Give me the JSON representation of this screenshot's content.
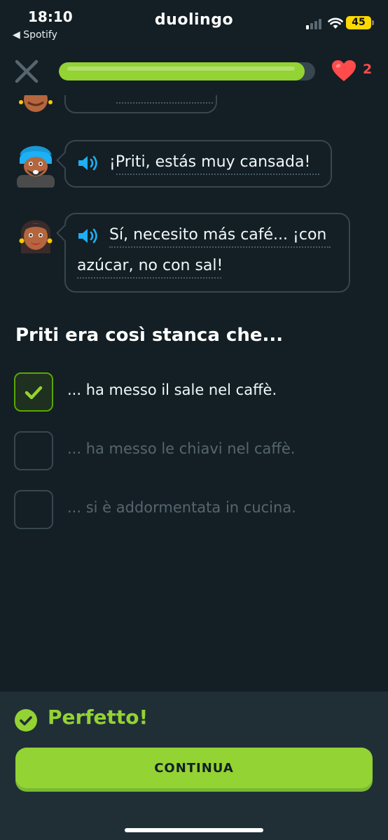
{
  "status_bar": {
    "time": "18:10",
    "back_app": "◀ Spotify",
    "app_name": "duolingo",
    "battery": "45"
  },
  "header": {
    "progress": 0.96,
    "hearts": "2"
  },
  "chat": {
    "messages": [
      {
        "speaker_icon": "speaker-icon",
        "lines": [
          "¡Priti, estás muy cansada!"
        ]
      },
      {
        "speaker_icon": "speaker-icon",
        "lines": [
          "Sí, necesito más café... ¡con",
          "azúcar, no con sal!"
        ]
      }
    ]
  },
  "question": "Priti era così stanca che...",
  "options": [
    {
      "label": "... ha messo il sale nel caffè.",
      "selected": true
    },
    {
      "label": "... ha messo le chiavi nel caffè.",
      "selected": false
    },
    {
      "label": "... si è addormentata in cucina.",
      "selected": false
    }
  ],
  "footer": {
    "result": "Perfetto!",
    "continue_label": "CONTINUA"
  },
  "colors": {
    "background": "#131f24",
    "accent_green": "#93d333",
    "heart_red": "#ff4b4b",
    "speaker_blue": "#1cb0f6"
  }
}
